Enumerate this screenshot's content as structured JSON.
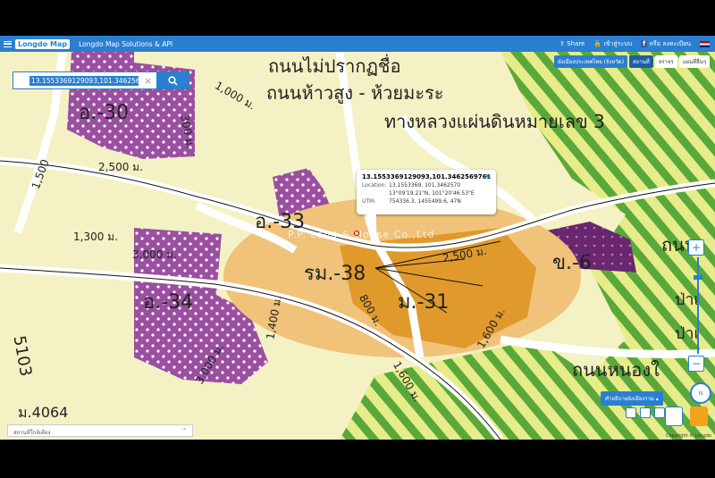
{
  "topbar": {
    "brand": "Longdo Map",
    "subtitle": "Longdo Map Solutions & API",
    "share": "Share",
    "login": "เข้าสู่ระบบ",
    "register": "หรือ ลงทะเบียน"
  },
  "search": {
    "value": "13.1553369129093,101.3462569"
  },
  "map_controls": {
    "layer_select": "ผังเมืองประเทศไทย (จังหวัด)",
    "mode_place": "สถานที่",
    "mode_traffic": "จราจร",
    "mode_other": "แผนที่อื่นๆ"
  },
  "popup": {
    "title": "13.1553369129093,101.3462569761",
    "location_label": "Location:",
    "location_decimal": "13.1553369, 101.3462570",
    "location_dms": "13°09'19.21\"N, 101°20'46.53\"E",
    "utm_label": "UTM:",
    "utm_value": "754336.3, 1455499.6, 47N"
  },
  "map_labels": {
    "zone_o30": "อ.-30",
    "zone_o33": "อ.-33",
    "zone_o34": "อ.-34",
    "zone_rm38": "รม.-38",
    "zone_m31": "ม.-31",
    "zone_kho6": "ข.-6",
    "road_top": "ถนนไม่ปรากฏชื่อ",
    "road_huaiwang": "ถนนห้าวสูง - ห้วยมะระ",
    "highway": "ทางหลวงแผ่นดินหมายเลข 3",
    "road_nong": "ถนนหนองใ",
    "dist_2500a": "2,500 ม.",
    "dist_2500b": "2,500 ม.",
    "dist_1300": "1,300 ม.",
    "dist_3000a": "3,000 ม.",
    "dist_3000b": "3,000 ม.",
    "dist_1400": "1,400 ม.",
    "dist_800": "800 ม.",
    "dist_1600a": "1,600 ม.",
    "dist_1600b": "1,600 ม.",
    "dist_1500": "1,500",
    "dist_1000": "1,000 ม.",
    "dist_300": "300 ม.",
    "num_5103": "5103",
    "num_4064": "ม.4064",
    "watermark": "P.P. Land & House Co.,Ltd",
    "pa_1": "ป่าเ",
    "pa_2": "ป่าเ",
    "road_right": "ถนน"
  },
  "legend_button": "คำอธิบายผังเมืองรวม",
  "bottom_bar": "สถานที่ใกล้เคียง",
  "copyright": "Copyright © Longdo",
  "compass_label": "N"
}
